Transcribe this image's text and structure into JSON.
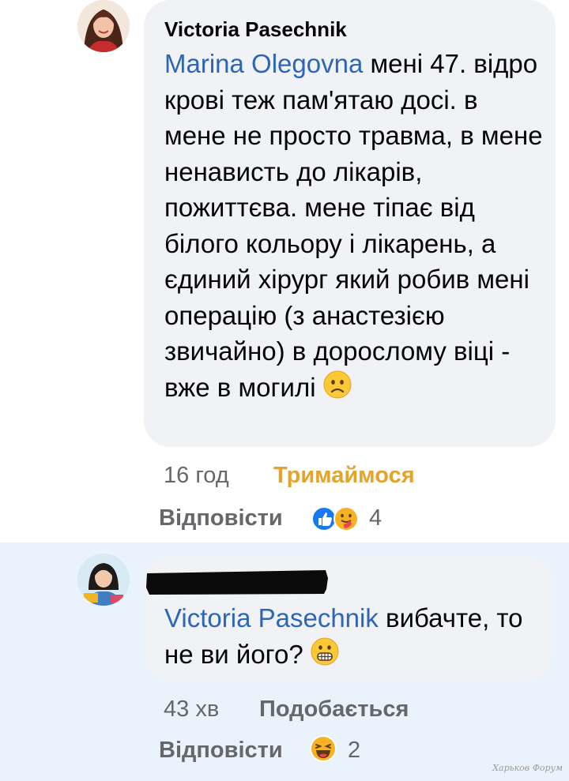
{
  "comments": [
    {
      "author": "Victoria Pasechnik",
      "mention": "Marina Olegovna",
      "text": " мені 47. відро крові теж пам'ятаю досі. в мене не просто травма, в мене ненависть до лікарів, пожиттєва. мене тіпає від білого кольору і лікарень, а єдиний хірург який робив мені операцію (з анастезією звичайно) в дорослому віці - вже в могилі",
      "emoji": "worried-face",
      "time": "16 год",
      "reaction_label": "Тримаймося",
      "reply_label": "Відповісти",
      "reaction_icons": [
        "like-icon",
        "care-icon"
      ],
      "reaction_count": "4"
    },
    {
      "author_redacted": true,
      "mention": "Victoria Pasechnik",
      "text": " вибачте, то не ви його?",
      "emoji": "grimacing-face",
      "time": "43 хв",
      "like_label": "Подобається",
      "reply_label": "Відповісти",
      "reaction_icons": [
        "haha-icon"
      ],
      "reaction_count": "2"
    }
  ],
  "watermark": "Харьков Форум",
  "colors": {
    "mention": "#2d66b6",
    "bubble": "#f0f2f5",
    "highlight": "#eaf3fc",
    "reaction_orange": "#e3a42c",
    "meta_gray": "#65676b"
  }
}
